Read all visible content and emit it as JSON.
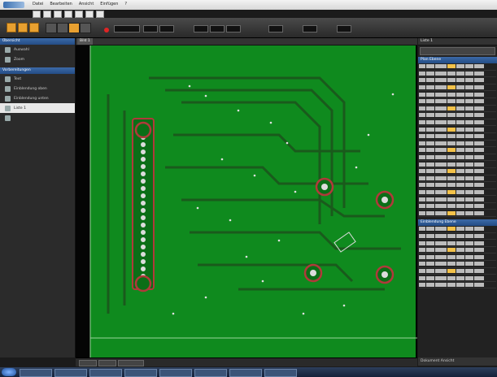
{
  "app": {
    "menu": [
      "Datei",
      "Bearbeiten",
      "Ansicht",
      "Einfügen",
      "?"
    ]
  },
  "left_panel": {
    "section1_title": "Übersicht",
    "section1_items": [
      "Auswahl",
      "Zoom"
    ],
    "section2_title": "Vorbereitungen",
    "section2_items": [
      "Text",
      "Einblendung oben",
      "Einblendung unten",
      "Liste 1",
      ""
    ]
  },
  "viewer": {
    "tab": "Bild 1",
    "board_colors": {
      "base": "#0f8a1e",
      "trace": "#1a5a1c",
      "pad": "#dcdcdc",
      "circle": "#b03a3a"
    }
  },
  "right_panel": {
    "tab": "Liste 1",
    "title1": "Plan Ebene",
    "title2": "Einblendung Ebene",
    "footer": "Dokument Ansicht"
  },
  "colors": {
    "accent": "#3b6aa8",
    "record": "#e02424"
  }
}
